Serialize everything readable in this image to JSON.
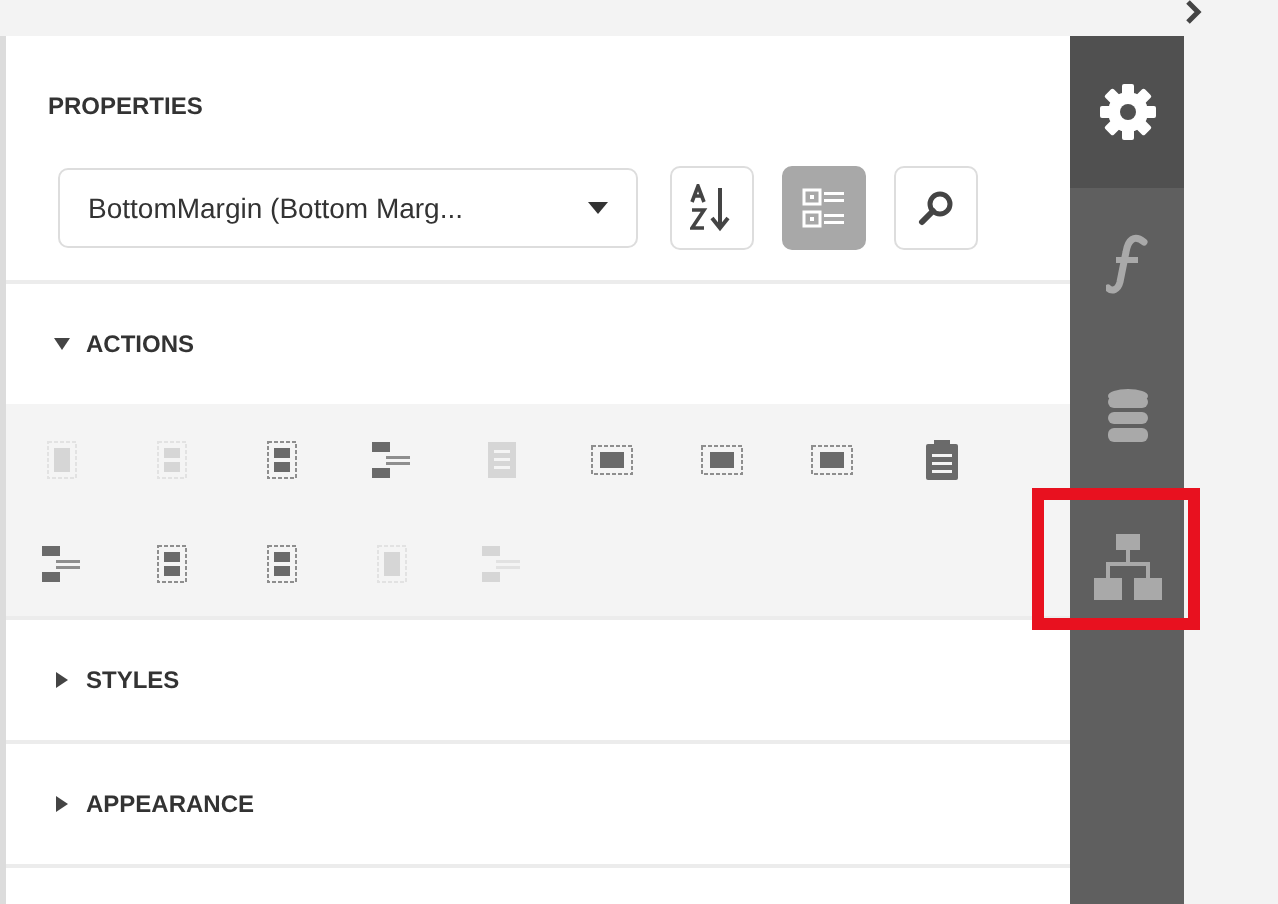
{
  "properties": {
    "title": "PROPERTIES",
    "selector": {
      "value": "BottomMargin (Bottom Marg..."
    },
    "tools": [
      {
        "kind": "sort",
        "selected": false
      },
      {
        "kind": "categories",
        "selected": true
      },
      {
        "kind": "search",
        "selected": false
      }
    ]
  },
  "sections": [
    {
      "title": "ACTIONS",
      "expanded": true,
      "actions": [
        {
          "kind": "box",
          "disabled": true
        },
        {
          "kind": "stack",
          "disabled": true
        },
        {
          "kind": "stack",
          "disabled": false
        },
        {
          "kind": "align",
          "disabled": false
        },
        {
          "kind": "page",
          "disabled": true
        },
        {
          "kind": "columns",
          "disabled": false
        },
        {
          "kind": "columns",
          "disabled": false
        },
        {
          "kind": "columns",
          "disabled": false
        },
        {
          "kind": "clipboard",
          "disabled": false
        },
        {
          "kind": "align",
          "disabled": false
        },
        {
          "kind": "stack",
          "disabled": false
        },
        {
          "kind": "stack",
          "disabled": false
        },
        {
          "kind": "box",
          "disabled": true
        },
        {
          "kind": "align",
          "disabled": true
        }
      ]
    },
    {
      "title": "STYLES",
      "expanded": false
    },
    {
      "title": "APPEARANCE",
      "expanded": false
    }
  ],
  "sidebar": {
    "tabs": [
      {
        "kind": "properties",
        "selected": true,
        "highlighted": false
      },
      {
        "kind": "expressions",
        "selected": false,
        "highlighted": false
      },
      {
        "kind": "data",
        "selected": false,
        "highlighted": false
      },
      {
        "kind": "structure",
        "selected": false,
        "highlighted": true
      }
    ]
  }
}
